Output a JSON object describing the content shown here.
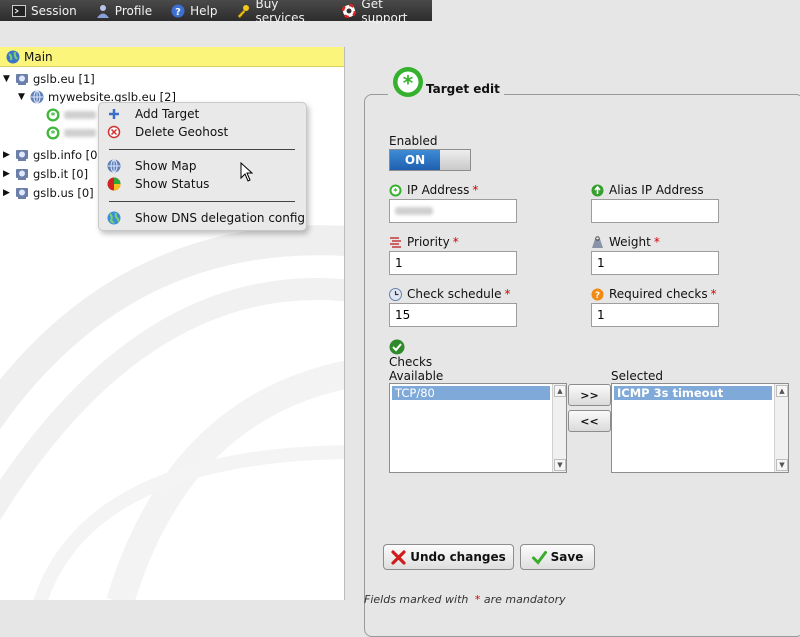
{
  "topmenu": {
    "items": [
      {
        "label": "Session",
        "icon": "terminal-icon"
      },
      {
        "label": "Profile",
        "icon": "user-icon"
      },
      {
        "label": "Help",
        "icon": "help-icon"
      },
      {
        "label": "Buy services",
        "icon": "key-icon"
      },
      {
        "label": "Get support",
        "icon": "lifebuoy-icon"
      }
    ]
  },
  "tree": {
    "header": "Main",
    "nodes": [
      {
        "label": "gslb.eu [1]"
      },
      {
        "label": "mywebsite.gslb.eu [2]"
      },
      {
        "label": "gslb.info [0]"
      },
      {
        "label": "gslb.it [0]"
      },
      {
        "label": "gslb.us [0]"
      }
    ]
  },
  "context_menu": {
    "items": [
      {
        "label": "Add Target",
        "icon": "plus-icon"
      },
      {
        "label": "Delete Geohost",
        "icon": "delete-icon"
      },
      {
        "label": "Show Map",
        "icon": "globe-icon"
      },
      {
        "label": "Show Status",
        "icon": "status-pie-icon"
      },
      {
        "label": "Show DNS delegation config",
        "icon": "world-icon"
      }
    ]
  },
  "form": {
    "legend": "Target edit",
    "enabled_label": "Enabled",
    "toggle_on": "ON",
    "ip_label": "IP Address",
    "alias_label": "Alias IP Address",
    "priority_label": "Priority",
    "priority_value": "1",
    "weight_label": "Weight",
    "weight_value": "1",
    "schedule_label": "Check schedule",
    "schedule_value": "15",
    "required_label": "Required checks",
    "required_value": "1",
    "checks_label": "Checks",
    "available_label": "Available",
    "selected_label": "Selected",
    "available_options": [
      "TCP/80"
    ],
    "selected_options": [
      "ICMP 3s timeout"
    ],
    "move_right": ">>",
    "move_left": "<<",
    "undo_label": "Undo changes",
    "save_label": "Save",
    "required_mark": "*",
    "footnote_prefix": "Fields marked with",
    "footnote_suffix": "are mandatory"
  },
  "colors": {
    "menubar": "#333333",
    "header_yellow": "#fbf57c",
    "toggle_blue": "#2a6fc2",
    "required_red": "#d40000",
    "list_selected": "#7ea9d8"
  }
}
